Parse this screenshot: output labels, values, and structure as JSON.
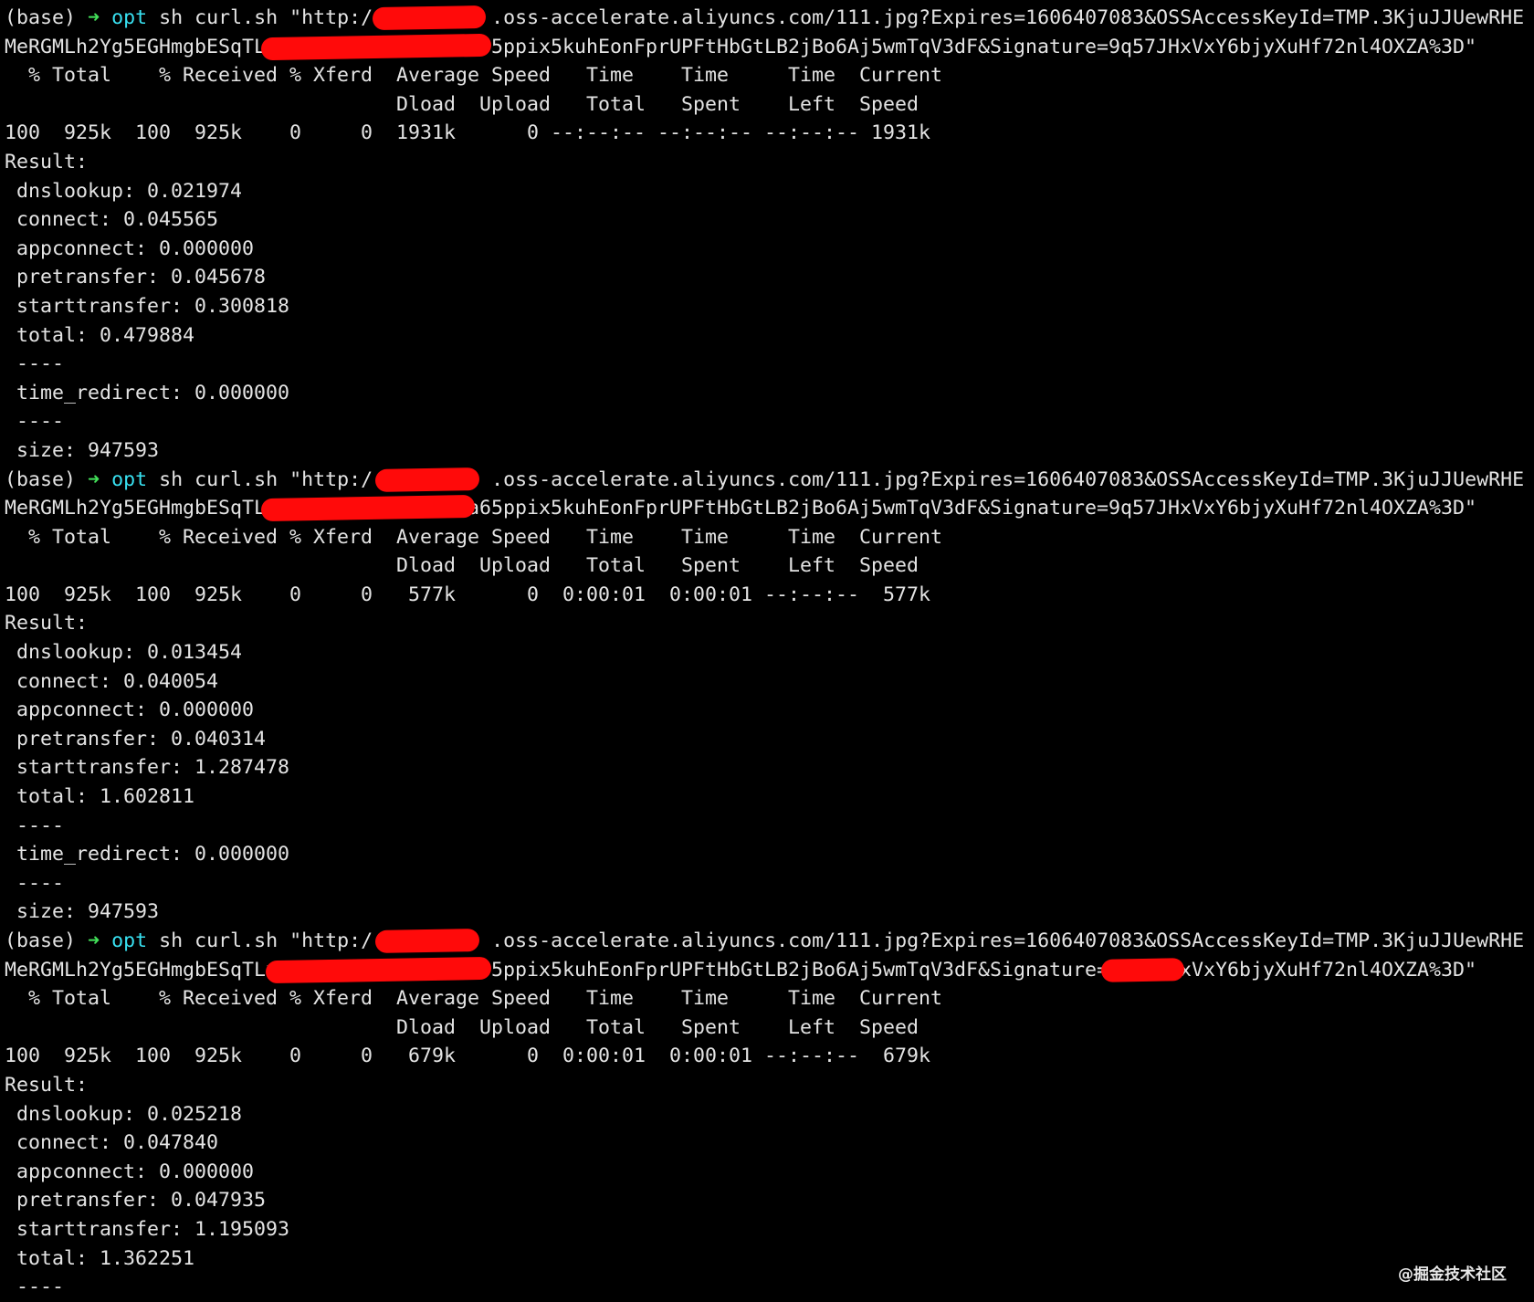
{
  "colors": {
    "background": "#000000",
    "text": "#e4e4e4",
    "prompt_arrow": "#43e25a",
    "prompt_dir": "#38e0f0",
    "redaction": "#ff0a0a"
  },
  "prompt": {
    "env": "(base)",
    "arrow": "➜",
    "dir": "opt"
  },
  "blocks": [
    {
      "cmd_start": " sh curl.sh \"http:/",
      "cmd_host_rest": ".oss-accelerate.aliyuncs.com/111.jpg?Expires=1606407083&OSSAccessKeyId=TMP.3KjuJJUewRHE",
      "line2_start": "MeRGMLh2Yg5EGHmgbESqTL",
      "line2_mid": "5ppix5kuhEonFprUPFtHbGtLB2jBo6Aj5wmTqV3dF&Signature=9q57JHxVxY6bjyXuHf72nl4OXZA%3D\"",
      "line2_end": "",
      "header1": "  % Total    % Received % Xferd  Average Speed   Time    Time     Time  Current",
      "header2": "                                 Dload  Upload   Total   Spent    Left  Speed",
      "progress": "100  925k  100  925k    0     0  1931k      0 --:--:-- --:--:-- --:--:-- 1931k",
      "result_label": "Result:",
      "stats": [
        " dnslookup: 0.021974",
        " connect: 0.045565",
        " appconnect: 0.000000",
        " pretransfer: 0.045678",
        " starttransfer: 0.300818",
        " total: 0.479884",
        " ----",
        " time_redirect: 0.000000",
        " ----",
        " size: 947593"
      ]
    },
    {
      "cmd_start": " sh curl.sh \"http:/",
      "cmd_host_rest": ".oss-accelerate.aliyuncs.com/111.jpg?Expires=1606407083&OSSAccessKeyId=TMP.3KjuJJUewRHE",
      "line2_start": "MeRGMLh2Yg5EGHmgbESqTL",
      "line2_mid": "a65ppix5kuhEonFprUPFtHbGtLB2jBo6Aj5wmTqV3dF&Signature=9q57JHxVxY6bjyXuHf72nl4OXZA%3D\"",
      "line2_end": "",
      "header1": "  % Total    % Received % Xferd  Average Speed   Time    Time     Time  Current",
      "header2": "                                 Dload  Upload   Total   Spent    Left  Speed",
      "progress": "100  925k  100  925k    0     0   577k      0  0:00:01  0:00:01 --:--:--  577k",
      "result_label": "Result:",
      "stats": [
        " dnslookup: 0.013454",
        " connect: 0.040054",
        " appconnect: 0.000000",
        " pretransfer: 0.040314",
        " starttransfer: 1.287478",
        " total: 1.602811",
        " ----",
        " time_redirect: 0.000000",
        " ----",
        " size: 947593"
      ]
    },
    {
      "cmd_start": " sh curl.sh \"http:/",
      "cmd_host_rest": ".oss-accelerate.aliyuncs.com/111.jpg?Expires=1606407083&OSSAccessKeyId=TMP.3KjuJJUewRHE",
      "line2_start": "MeRGMLh2Yg5EGHmgbESqTLx",
      "line2_mid": "5ppix5kuhEonFprUPFtHbGtLB2jBo6Aj5wmTqV3dF&Signature=",
      "line2_end": "xVxY6bjyXuHf72nl4OXZA%3D\"",
      "header1": "  % Total    % Received % Xferd  Average Speed   Time    Time     Time  Current",
      "header2": "                                 Dload  Upload   Total   Spent    Left  Speed",
      "progress": "100  925k  100  925k    0     0   679k      0  0:00:01  0:00:01 --:--:--  679k",
      "result_label": "Result:",
      "stats": [
        " dnslookup: 0.025218",
        " connect: 0.047840",
        " appconnect: 0.000000",
        " pretransfer: 0.047935",
        " starttransfer: 1.195093",
        " total: 1.362251",
        " ----"
      ]
    }
  ],
  "watermark": "@掘金技术社区"
}
